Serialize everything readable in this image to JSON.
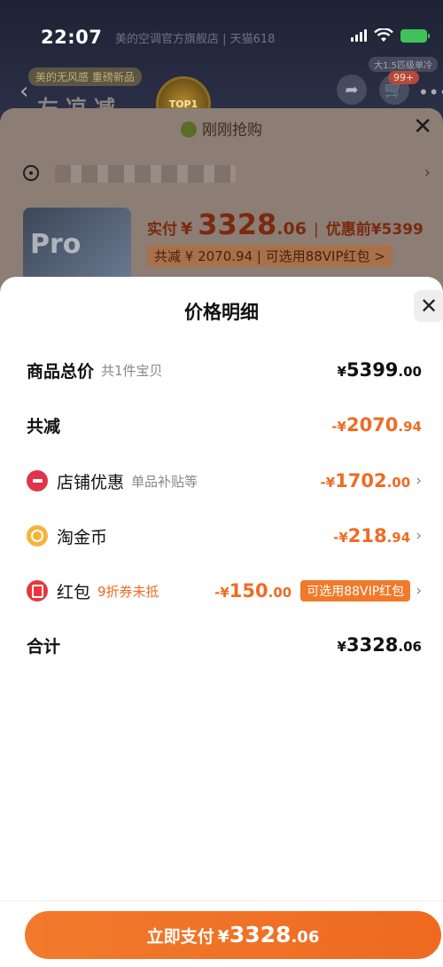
{
  "status_bar": {
    "time": "22:07",
    "store_title": "美的空调官方旗舰店 | 天猫618"
  },
  "background_page": {
    "promo_badge": "美的无风感 重磅新品",
    "promo_big": "左凉减",
    "rank_badge": "TOP1",
    "cart_count": "99+",
    "corner_tag": "大1.5匹级单冷",
    "purchase_sheet": {
      "title": "刚刚抢购",
      "product_thumb_text": "Pro",
      "actual_pay_label": "实付",
      "actual_pay_currency": "¥",
      "actual_pay_int": "3328",
      "actual_pay_dec": ".06",
      "before_discount_label": "优惠前",
      "before_discount_price": "¥5399",
      "saving_text": "共减 ¥ 2070.94 | 可选用88VIP红包 >"
    }
  },
  "price_detail": {
    "title": "价格明细",
    "rows": [
      {
        "label": "商品总价",
        "sub": "共1件宝贝",
        "prefix": "¥",
        "int": "5399",
        "dec": ".00"
      },
      {
        "label": "共减",
        "sub": "",
        "prefix": "-¥",
        "int": "2070",
        "dec": ".94"
      },
      {
        "label": "店铺优惠",
        "sub": "单品补贴等",
        "prefix": "-¥",
        "int": "1702",
        "dec": ".00"
      },
      {
        "label": "淘金币",
        "sub": "",
        "prefix": "-¥",
        "int": "218",
        "dec": ".94"
      },
      {
        "label": "红包",
        "sub": "9折券未抵",
        "prefix": "-¥",
        "int": "150",
        "dec": ".00",
        "pill": "可选用88VIP红包"
      },
      {
        "label": "合计",
        "sub": "",
        "prefix": "¥",
        "int": "3328",
        "dec": ".06"
      }
    ]
  },
  "pay_button": {
    "label": "立即支付",
    "currency": "¥",
    "int": "3328",
    "dec": ".06"
  },
  "colors": {
    "accent": "#ee6c23",
    "shop_icon": "#e0344a",
    "coin_icon": "#f4b43a",
    "redpack_icon": "#e8353d"
  },
  "icons": {
    "close": "close-icon",
    "chevron": "chevron-right-icon",
    "shop": "shop-discount-icon",
    "coin": "taojinbi-coin-icon",
    "redpack": "red-packet-icon",
    "location": "location-pin-icon"
  }
}
